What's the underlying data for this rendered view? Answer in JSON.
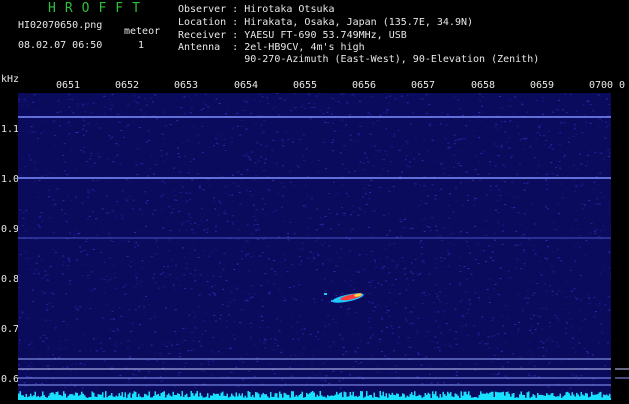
{
  "header": {
    "app_title": "HROFFT",
    "file_name": "HI02070650.png",
    "counter_label": "meteor",
    "date_time": "08.02.07 06:50",
    "meteor_count": "1",
    "observer": "Observer : Hirotaka Otsuka",
    "location": "Location : Hirakata, Osaka, Japan (135.7E, 34.9N)",
    "receiver": "Receiver : YAESU FT-690 53.749MHz, USB",
    "antenna": "Antenna  : 2el-HB9CV, 4m's high",
    "antenna_detail": "           90-270-Azimuth (East-West), 90-Elevation (Zenith)"
  },
  "axis": {
    "unit": "kHz",
    "time_ticks": [
      "0651",
      "0652",
      "0653",
      "0654",
      "0655",
      "0656",
      "0657",
      "0658",
      "0659",
      "0700"
    ],
    "end_tick": "0",
    "freq_ticks": [
      "1.1",
      "1.0",
      "0.9",
      "0.8",
      "0.7",
      "0.6"
    ]
  },
  "colors": {
    "background": "#0b0b5e",
    "carrier": "#7f8fff",
    "noise_floor": "#18e0ff",
    "title": "#2fbf3a"
  }
}
